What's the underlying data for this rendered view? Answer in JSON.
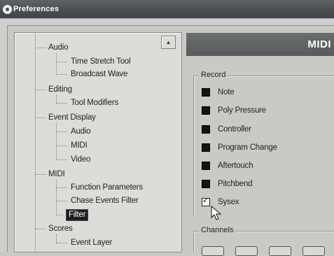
{
  "window": {
    "title": "Preferences"
  },
  "tree": {
    "items": [
      {
        "label": "Audio"
      },
      {
        "label": "Time Stretch Tool"
      },
      {
        "label": "Broadcast Wave"
      },
      {
        "label": "Editing"
      },
      {
        "label": "Tool Modifiers"
      },
      {
        "label": "Event Display"
      },
      {
        "label": "Audio"
      },
      {
        "label": "MIDI"
      },
      {
        "label": "Video"
      },
      {
        "label": "MIDI"
      },
      {
        "label": "Function Parameters"
      },
      {
        "label": "Chase Events Filter"
      },
      {
        "label": "Filter"
      },
      {
        "label": "Scores"
      },
      {
        "label": "Event Layer"
      }
    ],
    "selected": "Filter"
  },
  "panel": {
    "header": "MIDI",
    "record_group_label": "Record",
    "channels_group_label": "Channels",
    "record_options": [
      {
        "label": "Note",
        "checked": false
      },
      {
        "label": "Poly Pressure",
        "checked": false
      },
      {
        "label": "Controller",
        "checked": false
      },
      {
        "label": "Program Change",
        "checked": false
      },
      {
        "label": "Aftertouch",
        "checked": false
      },
      {
        "label": "Pitchbend",
        "checked": false
      },
      {
        "label": "Sysex",
        "checked": true
      }
    ]
  }
}
